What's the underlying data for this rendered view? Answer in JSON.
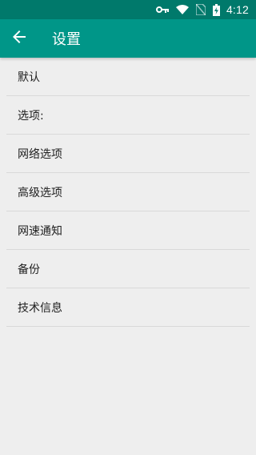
{
  "status_bar": {
    "time": "4:12",
    "icons": [
      "vpn-key-icon",
      "wifi-icon",
      "no-sim-icon",
      "battery-charging-icon"
    ]
  },
  "app_bar": {
    "title": "设置",
    "back_icon": "arrow-back-icon"
  },
  "settings": {
    "items": [
      {
        "label": "默认"
      },
      {
        "label": "选项:"
      },
      {
        "label": "网络选项"
      },
      {
        "label": "高级选项"
      },
      {
        "label": "网速通知"
      },
      {
        "label": "备份"
      },
      {
        "label": "技术信息"
      }
    ]
  },
  "colors": {
    "status_bar": "#00796b",
    "app_bar": "#009688",
    "background": "#eeeeee",
    "divider": "#d9d9d9",
    "text": "#212121"
  }
}
